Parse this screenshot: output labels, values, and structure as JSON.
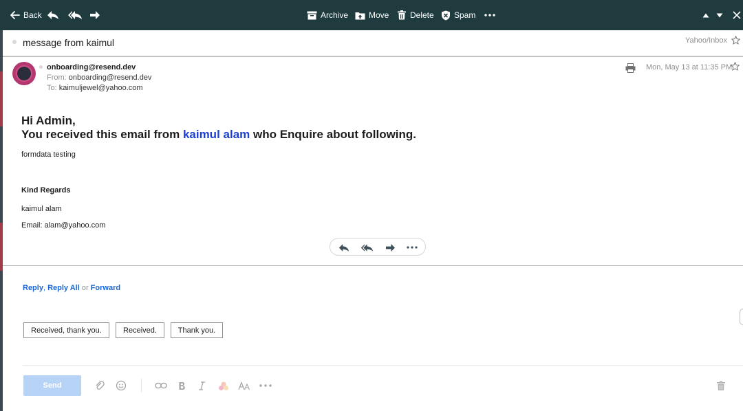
{
  "toolbar": {
    "back_label": "Back",
    "archive_label": "Archive",
    "move_label": "Move",
    "delete_label": "Delete",
    "spam_label": "Spam"
  },
  "message": {
    "subject": "message from kaimul",
    "folder": "Yahoo/Inbox",
    "sender": "onboarding@resend.dev",
    "from_label": "From:",
    "from_value": "onboarding@resend.dev",
    "to_label": "To:",
    "to_value": "kaimuljewel@yahoo.com",
    "date": "Mon, May 13 at 11:35 PM"
  },
  "body": {
    "greeting": "Hi Admin,",
    "line_prefix": "You received this email from ",
    "line_name": "kaimul alam",
    "line_suffix": " who Enquire about following.",
    "form_data": "formdata testing",
    "regards": "Kind Regards",
    "signature_name": "kaimul alam",
    "signature_email": "Email: alam@yahoo.com"
  },
  "reply": {
    "reply_label": "Reply",
    "comma": ",",
    "reply_all_label": "Reply All",
    "or_label": "or",
    "forward_label": "Forward",
    "quick_replies": [
      "Received, thank you.",
      "Received.",
      "Thank you."
    ],
    "send_label": "Send"
  },
  "icons": {
    "toolbar": [
      "back-arrow-icon",
      "reply-icon",
      "reply-all-icon",
      "forward-icon",
      "archive-icon",
      "move-icon",
      "delete-icon",
      "spam-shield-icon",
      "more-icon",
      "previous-icon",
      "next-icon",
      "close-icon"
    ],
    "composer": [
      "attach-icon",
      "emoji-icon",
      "link-icon",
      "bold-icon",
      "italic-icon",
      "color-icon",
      "font-size-icon",
      "more-icon",
      "trash-icon"
    ]
  },
  "colors": {
    "toolbar_bg": "#1f3b3e",
    "link_blue": "#1a66d6",
    "name_blue": "#1c3fd1",
    "send_disabled": "#b7d3f6",
    "avatar": "#b2386f"
  }
}
